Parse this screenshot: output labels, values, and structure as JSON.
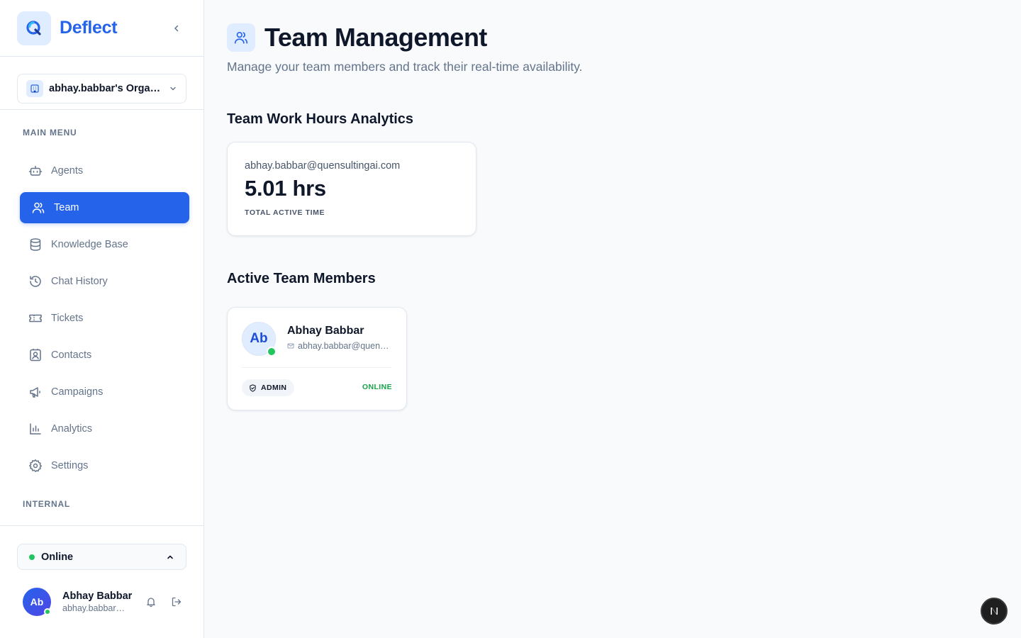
{
  "brand": {
    "name": "Deflect"
  },
  "org": {
    "name": "abhay.babbar's Organization"
  },
  "sidebar": {
    "main_menu_label": "MAIN MENU",
    "internal_label": "INTERNAL",
    "items": [
      {
        "label": "Agents",
        "icon": "bot-icon",
        "active": false
      },
      {
        "label": "Team",
        "icon": "users-icon",
        "active": true
      },
      {
        "label": "Knowledge Base",
        "icon": "database-icon",
        "active": false
      },
      {
        "label": "Chat History",
        "icon": "history-icon",
        "active": false
      },
      {
        "label": "Tickets",
        "icon": "ticket-icon",
        "active": false
      },
      {
        "label": "Contacts",
        "icon": "contact-icon",
        "active": false
      },
      {
        "label": "Campaigns",
        "icon": "megaphone-icon",
        "active": false
      },
      {
        "label": "Analytics",
        "icon": "bar-chart-icon",
        "active": false
      },
      {
        "label": "Settings",
        "icon": "gear-icon",
        "active": false
      }
    ]
  },
  "status": {
    "label": "Online",
    "color": "#22c55e"
  },
  "user": {
    "initials": "Ab",
    "name": "Abhay Babbar",
    "email": "abhay.babbar@quensultingai.com"
  },
  "page": {
    "title": "Team Management",
    "subtitle": "Manage your team members and track their real-time availability."
  },
  "analytics": {
    "title": "Team Work Hours Analytics",
    "email": "abhay.babbar@quensultingai.com",
    "value": "5.01 hrs",
    "label": "TOTAL ACTIVE TIME"
  },
  "members": {
    "title": "Active Team Members",
    "list": [
      {
        "initials": "Ab",
        "name": "Abhay Babbar",
        "email": "abhay.babbar@quensultingai.com",
        "role": "ADMIN",
        "status": "ONLINE"
      }
    ]
  },
  "colors": {
    "accent": "#2563eb",
    "online": "#22c55e",
    "online_text": "#16a34a"
  }
}
